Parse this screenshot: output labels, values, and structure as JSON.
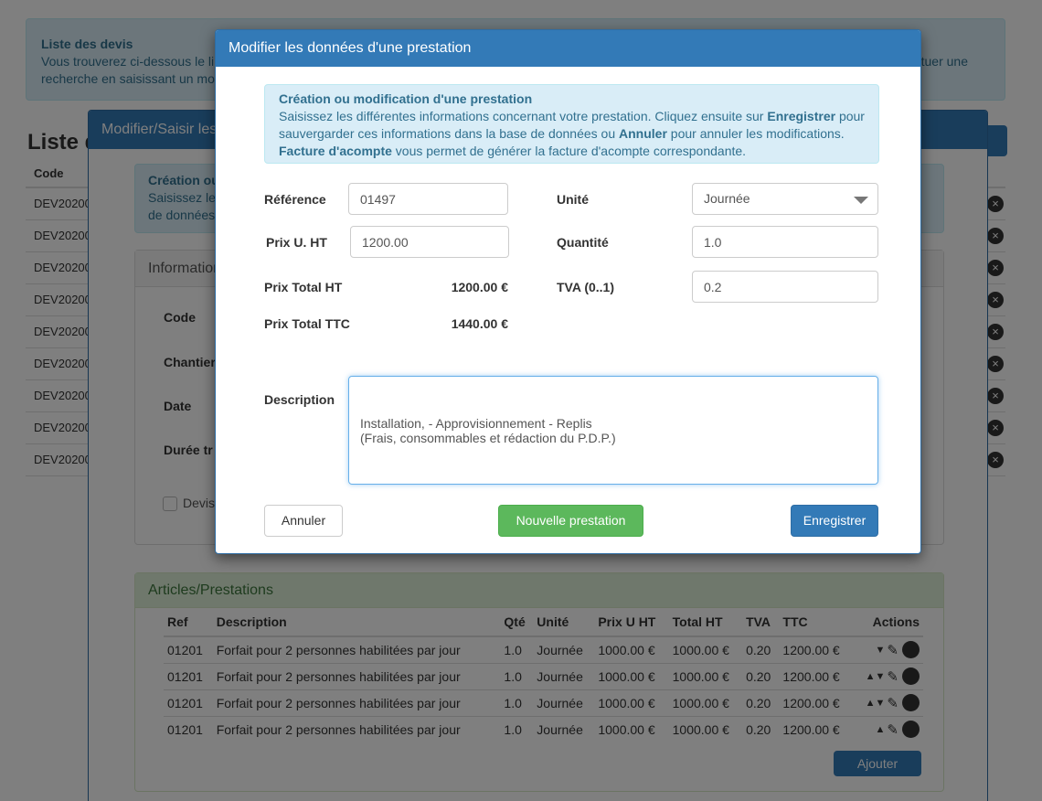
{
  "background": {
    "info_title": "Liste des devis",
    "info_text_1": "Vous trouverez ci-dessous le li",
    "info_text_1_right": "tuer une",
    "info_text_2": "recherche en saisissant un mo",
    "page_title": "Liste d",
    "code_header": "Code",
    "rows": [
      "DEV20200",
      "DEV20200",
      "DEV20200",
      "DEV20200",
      "DEV20200",
      "DEV20200",
      "DEV20200",
      "DEV20200",
      "DEV20200"
    ]
  },
  "modal2": {
    "title": "Modifier/Saisir les",
    "alert_title": "Création ou",
    "alert_line1": "Saisissez les",
    "alert_line2": "de données",
    "panel_title": "Information",
    "labels": [
      "Code",
      "Chantier",
      "Date",
      "Durée tr"
    ],
    "checkbox_label": "Devis",
    "articles": {
      "title": "Articles/Prestations",
      "headers": [
        "Ref",
        "Description",
        "Qté",
        "Unité",
        "Prix U HT",
        "Total HT",
        "TVA",
        "TTC",
        "Actions"
      ],
      "rows": [
        [
          "01201",
          "Forfait pour 2 personnes habilitées par jour",
          "1.0",
          "Journée",
          "1000.00 €",
          "1000.00 €",
          "0.20",
          "1200.00 €"
        ],
        [
          "01201",
          "Forfait pour 2 personnes habilitées par jour",
          "1.0",
          "Journée",
          "1000.00 €",
          "1000.00 €",
          "0.20",
          "1200.00 €"
        ],
        [
          "01201",
          "Forfait pour 2 personnes habilitées par jour",
          "1.0",
          "Journée",
          "1000.00 €",
          "1000.00 €",
          "0.20",
          "1200.00 €"
        ],
        [
          "01201",
          "Forfait pour 2 personnes habilitées par jour",
          "1.0",
          "Journée",
          "1000.00 €",
          "1000.00 €",
          "0.20",
          "1200.00 €"
        ]
      ],
      "add_label": "Ajouter"
    }
  },
  "modal": {
    "title": "Modifier les données d'une prestation",
    "alert": {
      "title": "Création ou modification d'une prestation",
      "t1": "Saisissez les différentes informations concernant votre prestation. Cliquez ensuite sur ",
      "b1": "Enregistrer",
      "t2": "pour sauvergarder ces informations dans la base de données ou ",
      "b2": "Annuler",
      "t3": " pour annuler les modifications. ",
      "b3": "Facture d'acompte",
      "t4": " vous permet de générer la facture d'acompte correspondante."
    },
    "reference_label": "Référence",
    "reference_value": "01497",
    "unite_label": "Unité",
    "unite_value": "Journée",
    "prix_label": "Prix U. HT",
    "prix_value": "1200.00",
    "quantite_label": "Quantité",
    "quantite_value": "1.0",
    "prix_total_ht_label": "Prix Total HT",
    "prix_total_ht_value": "1200.00 €",
    "tva_label": "TVA (0..1)",
    "tva_value": "0.2",
    "prix_total_ttc_label": "Prix Total TTC",
    "prix_total_ttc_value": "1440.00 €",
    "description_label": "Description",
    "description_value": "Installation, - Approvisionnement - Replis\n(Frais, consommables et rédaction du P.D.P.)",
    "cancel_label": "Annuler",
    "new_label": "Nouvelle prestation",
    "save_label": "Enregistrer"
  }
}
